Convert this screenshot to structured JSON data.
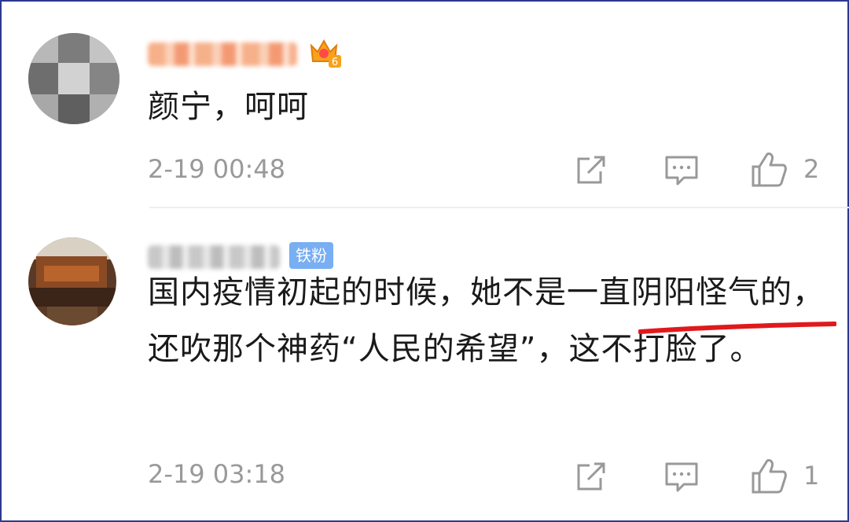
{
  "comments": [
    {
      "username": "小飞燕燕燕",
      "badge": "6",
      "text": "颜宁，呵呵",
      "time": "2-19 00:48",
      "likes": "2"
    },
    {
      "username": "zhenya007",
      "badge": "铁粉",
      "text": "国内疫情初起的时候，她不是一直阴阳怪气的，还吹那个神药“人民的希望”，这不打脸了。",
      "time": "2-19 03:18",
      "likes": "1"
    }
  ],
  "colors": {
    "badge_blue": "#78aef2",
    "underline_red": "#e0191c",
    "meta_gray": "#999999"
  },
  "icons": [
    "share-icon",
    "comment-icon",
    "like-icon",
    "crown-icon"
  ]
}
